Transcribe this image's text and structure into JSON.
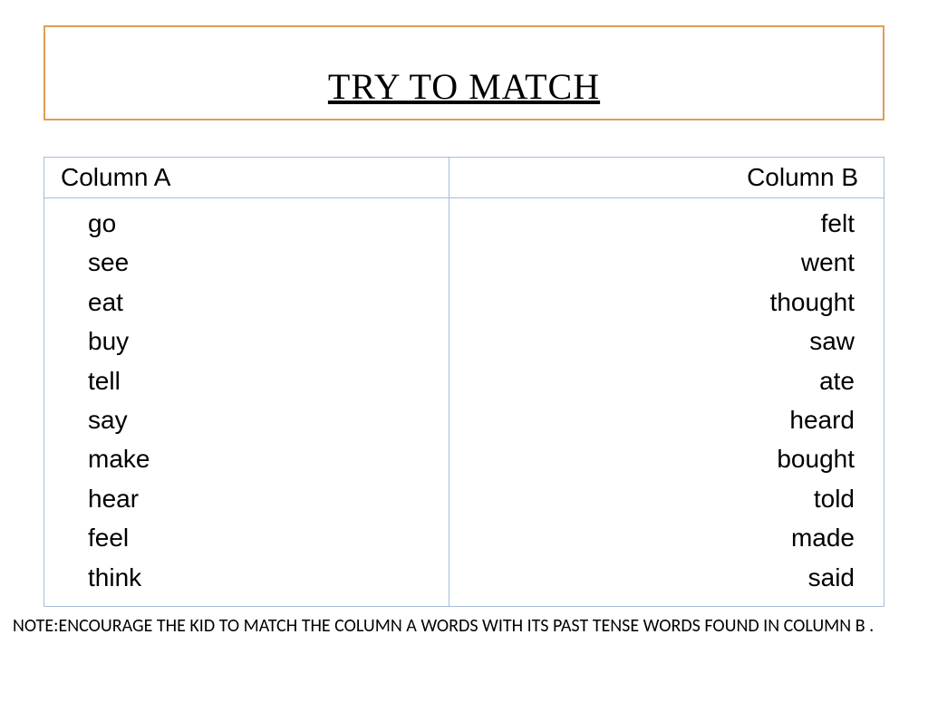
{
  "title": "TRY TO MATCH",
  "table": {
    "headers": {
      "a": "Column A",
      "b": "Column B"
    },
    "columnA": [
      "go",
      "see",
      "eat",
      "buy",
      "tell",
      "say",
      "make",
      "hear",
      "feel",
      "think"
    ],
    "columnB": [
      "felt",
      "went",
      "thought",
      "saw",
      "ate",
      "heard",
      "bought",
      "told",
      "made",
      "said"
    ]
  },
  "note": "NOTE:ENCOURAGE THE KID TO MATCH THE COLUMN A WORDS WITH ITS PAST TENSE WORDS FOUND IN COLUMN B ."
}
